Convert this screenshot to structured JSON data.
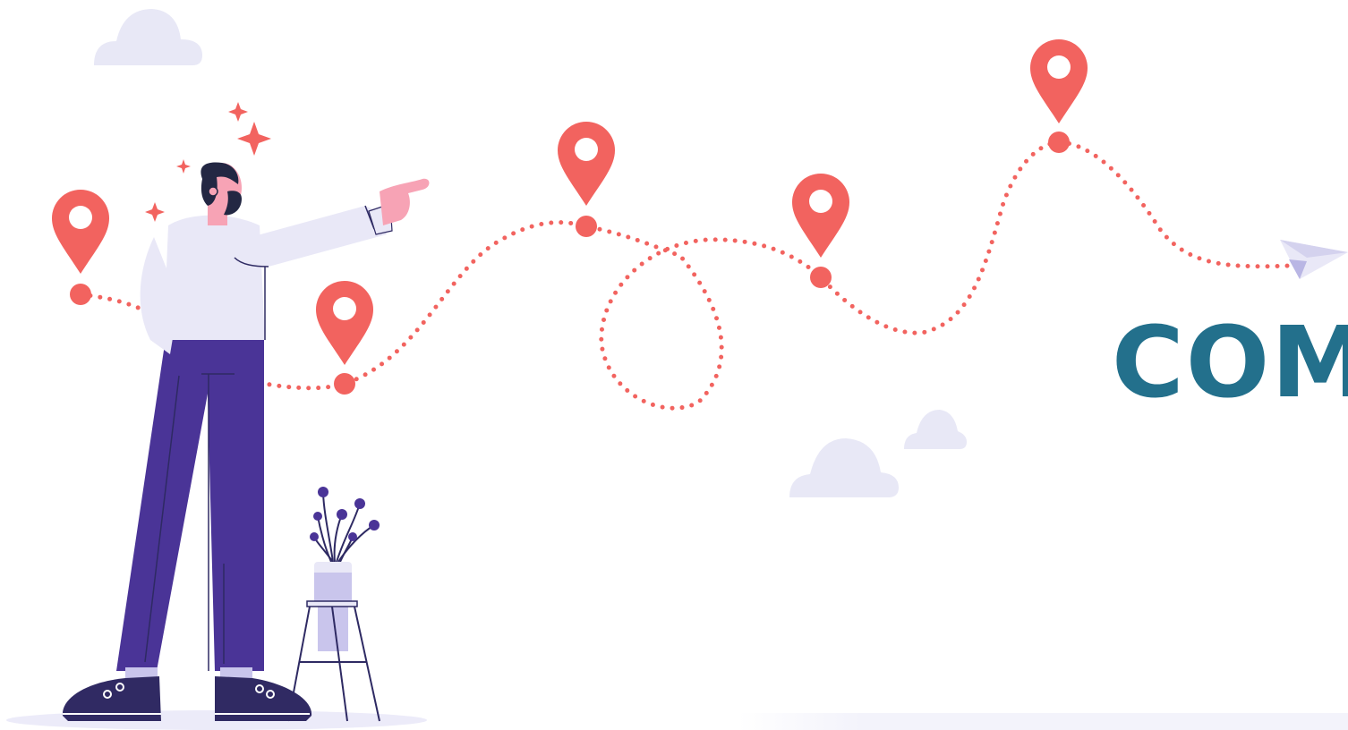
{
  "headline": "COM",
  "colors": {
    "route": "#f2635f",
    "pin": "#f2635f",
    "headline": "#23708c",
    "cloud": "#e8e8f6",
    "shirt": "#e9e8f7",
    "pants": "#4a3497",
    "skin": "#f7a3b5",
    "hair": "#232743",
    "shoes": "#302a63",
    "ground": "#ecebf9"
  },
  "icons": {
    "pin": "map-pin-icon",
    "sparkle": "sparkle-icon",
    "plane": "paper-plane-icon",
    "cloud": "cloud-shape"
  }
}
